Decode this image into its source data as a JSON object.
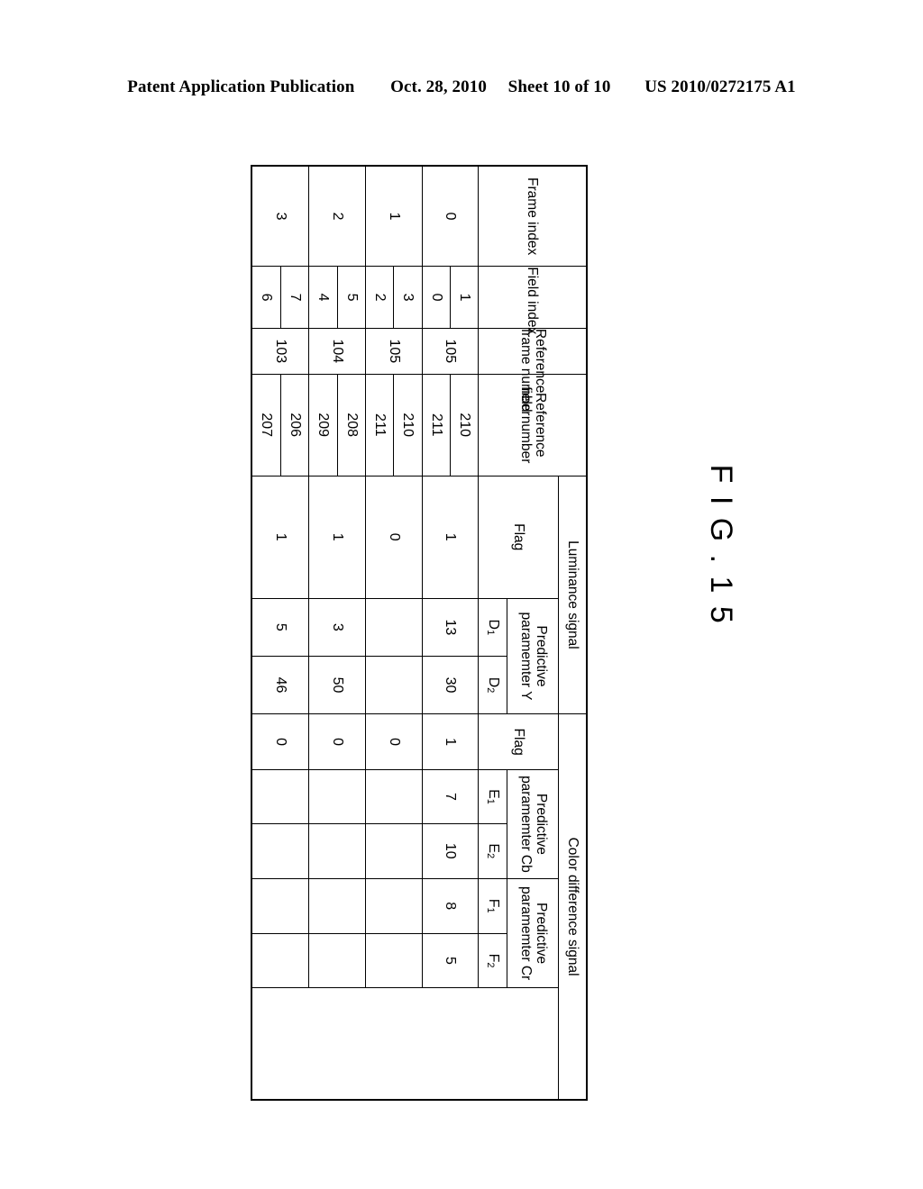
{
  "page_header": {
    "publication": "Patent Application Publication",
    "date": "Oct. 28, 2010",
    "sheet": "Sheet 10 of 10",
    "patent_number": "US 2010/0272175 A1"
  },
  "figure": {
    "label": "F I G . 1 5"
  },
  "table": {
    "group_headers": {
      "luminance": "Luminance signal",
      "color_difference": "Color difference signal"
    },
    "column_headers": {
      "frame_index": "Frame index",
      "field_index": "Field index",
      "reference_frame_number_l1": "Reference",
      "reference_frame_number_l2": "frame number",
      "reference_field_number_l1": "Reference",
      "reference_field_number_l2": "field number",
      "luma_flag": "Flag",
      "luma_param_l1": "Predictive",
      "luma_param_l2": "paramemter Y",
      "chroma_flag": "Flag",
      "cb_param_l1": "Predictive",
      "cb_param_l2": "paramemter Cb",
      "cr_param_l1": "Predictive",
      "cr_param_l2": "paramemter Cr"
    },
    "sub_headers": {
      "d1": "D",
      "d1_sub": "1",
      "d2": "D",
      "d2_sub": "2",
      "e1": "E",
      "e1_sub": "1",
      "e2": "E",
      "e2_sub": "2",
      "f1": "F",
      "f1_sub": "1",
      "f2": "F",
      "f2_sub": "2"
    },
    "rows": [
      {
        "frame_index": "0",
        "field_indices": [
          "1",
          "0"
        ],
        "reference_frame_number": "105",
        "reference_field_numbers": [
          "210",
          "211"
        ],
        "luma_flag": "1",
        "d1": "13",
        "d2": "30",
        "chroma_flag": "1",
        "e1": "7",
        "e2": "10",
        "f1": "8",
        "f2": "5"
      },
      {
        "frame_index": "1",
        "field_indices": [
          "3",
          "2"
        ],
        "reference_frame_number": "105",
        "reference_field_numbers": [
          "210",
          "211"
        ],
        "luma_flag": "0",
        "d1": "",
        "d2": "",
        "chroma_flag": "0",
        "e1": "",
        "e2": "",
        "f1": "",
        "f2": ""
      },
      {
        "frame_index": "2",
        "field_indices": [
          "5",
          "4"
        ],
        "reference_frame_number": "104",
        "reference_field_numbers": [
          "208",
          "209"
        ],
        "luma_flag": "1",
        "d1": "3",
        "d2": "50",
        "chroma_flag": "0",
        "e1": "",
        "e2": "",
        "f1": "",
        "f2": ""
      },
      {
        "frame_index": "3",
        "field_indices": [
          "7",
          "6"
        ],
        "reference_frame_number": "103",
        "reference_field_numbers": [
          "206",
          "207"
        ],
        "luma_flag": "1",
        "d1": "5",
        "d2": "46",
        "chroma_flag": "0",
        "e1": "",
        "e2": "",
        "f1": "",
        "f2": ""
      }
    ]
  }
}
